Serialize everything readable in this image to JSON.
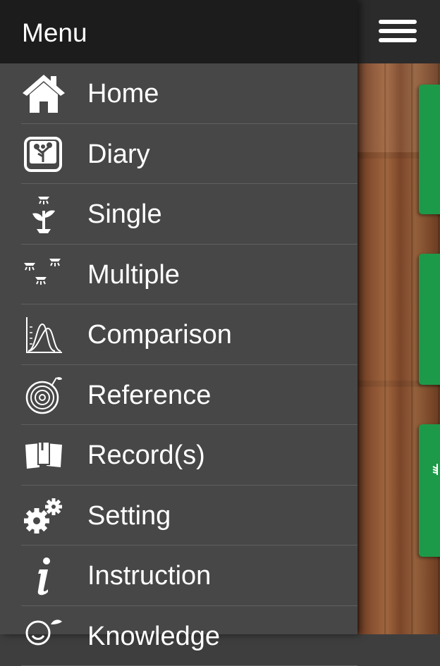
{
  "header": {
    "title": "Menu",
    "menu_icon": "hamburger-icon"
  },
  "menu": {
    "items": [
      {
        "label": "Home",
        "icon": "house-icon"
      },
      {
        "label": "Diary",
        "icon": "tree-book-icon"
      },
      {
        "label": "Single",
        "icon": "seedling-lamp-icon"
      },
      {
        "label": "Multiple",
        "icon": "multiple-lamps-icon"
      },
      {
        "label": "Comparison",
        "icon": "spectrum-chart-icon"
      },
      {
        "label": "Reference",
        "icon": "tree-rings-icon"
      },
      {
        "label": "Record(s)",
        "icon": "pinned-notes-icon"
      },
      {
        "label": "Setting",
        "icon": "gears-icon"
      },
      {
        "label": "Instruction",
        "icon": "info-icon"
      },
      {
        "label": "Knowledge",
        "icon": "bulb-leaf-icon"
      }
    ]
  },
  "colors": {
    "header_bg": "#1c1c1c",
    "drawer_bg": "#474747",
    "card_green": "#1d9a49",
    "wood": "#8a5232"
  }
}
